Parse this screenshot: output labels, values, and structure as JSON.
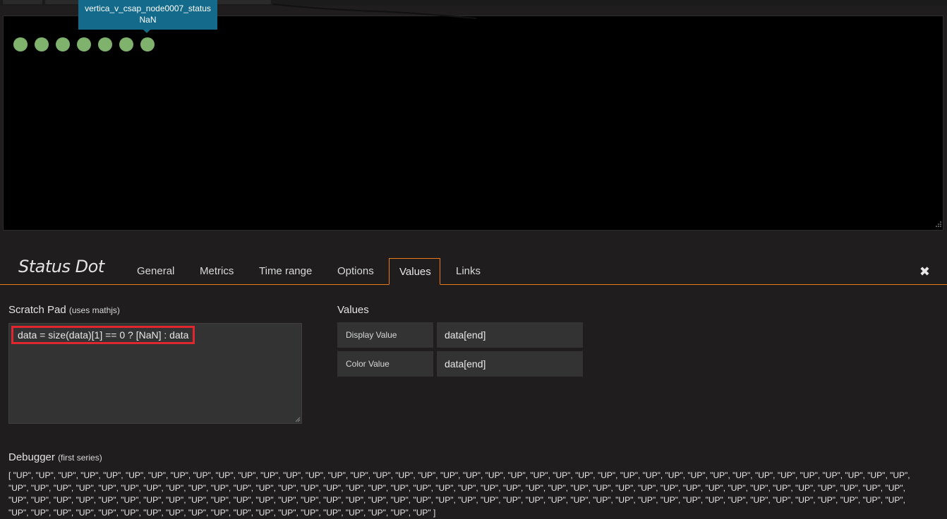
{
  "tooltip": {
    "series": "vertica_v_csap_node0007_status",
    "value": "NaN"
  },
  "status_dots": {
    "count": 7,
    "color": "#7eb26d"
  },
  "editor": {
    "title": "Status Dot",
    "tabs": [
      {
        "label": "General",
        "active": false
      },
      {
        "label": "Metrics",
        "active": false
      },
      {
        "label": "Time range",
        "active": false
      },
      {
        "label": "Options",
        "active": false
      },
      {
        "label": "Values",
        "active": true
      },
      {
        "label": "Links",
        "active": false
      }
    ],
    "close_icon": "close-icon",
    "accent": "#eb7b18"
  },
  "scratch_pad": {
    "title": "Scratch Pad",
    "note": "(uses mathjs)",
    "code": "data = size(data)[1] == 0 ? [NaN] : data",
    "highlight_color": "#e0262e"
  },
  "values": {
    "title": "Values",
    "display_label": "Display Value",
    "display_value": "data[end]",
    "color_label": "Color Value",
    "color_value": "data[end]"
  },
  "debugger": {
    "title": "Debugger",
    "note": "(first series)",
    "output": "[ \"UP\", \"UP\", \"UP\", \"UP\", \"UP\", \"UP\", \"UP\", \"UP\", \"UP\", \"UP\", \"UP\", \"UP\", \"UP\", \"UP\", \"UP\", \"UP\", \"UP\", \"UP\", \"UP\", \"UP\", \"UP\", \"UP\", \"UP\", \"UP\", \"UP\", \"UP\", \"UP\", \"UP\", \"UP\", \"UP\", \"UP\", \"UP\", \"UP\", \"UP\", \"UP\", \"UP\", \"UP\", \"UP\", \"UP\", \"UP\", \"UP\", \"UP\", \"UP\", \"UP\", \"UP\", \"UP\", \"UP\", \"UP\", \"UP\", \"UP\", \"UP\", \"UP\", \"UP\", \"UP\", \"UP\", \"UP\", \"UP\", \"UP\", \"UP\", \"UP\", \"UP\", \"UP\", \"UP\", \"UP\", \"UP\", \"UP\", \"UP\", \"UP\", \"UP\", \"UP\", \"UP\", \"UP\", \"UP\", \"UP\", \"UP\", \"UP\", \"UP\", \"UP\", \"UP\", \"UP\", \"UP\", \"UP\", \"UP\", \"UP\", \"UP\", \"UP\", \"UP\", \"UP\", \"UP\", \"UP\", \"UP\", \"UP\", \"UP\", \"UP\", \"UP\", \"UP\", \"UP\", \"UP\", \"UP\", \"UP\", \"UP\", \"UP\", \"UP\", \"UP\", \"UP\", \"UP\", \"UP\", \"UP\", \"UP\", \"UP\", \"UP\", \"UP\", \"UP\", \"UP\", \"UP\", \"UP\", \"UP\", \"UP\", \"UP\", \"UP\", \"UP\", \"UP\", \"UP\", \"UP\", \"UP\", \"UP\", \"UP\", \"UP\", \"UP\", \"UP\", \"UP\", \"UP\", \"UP\", \"UP\", \"UP\", \"UP\", \"UP\", \"UP\", \"UP\" ]"
  }
}
